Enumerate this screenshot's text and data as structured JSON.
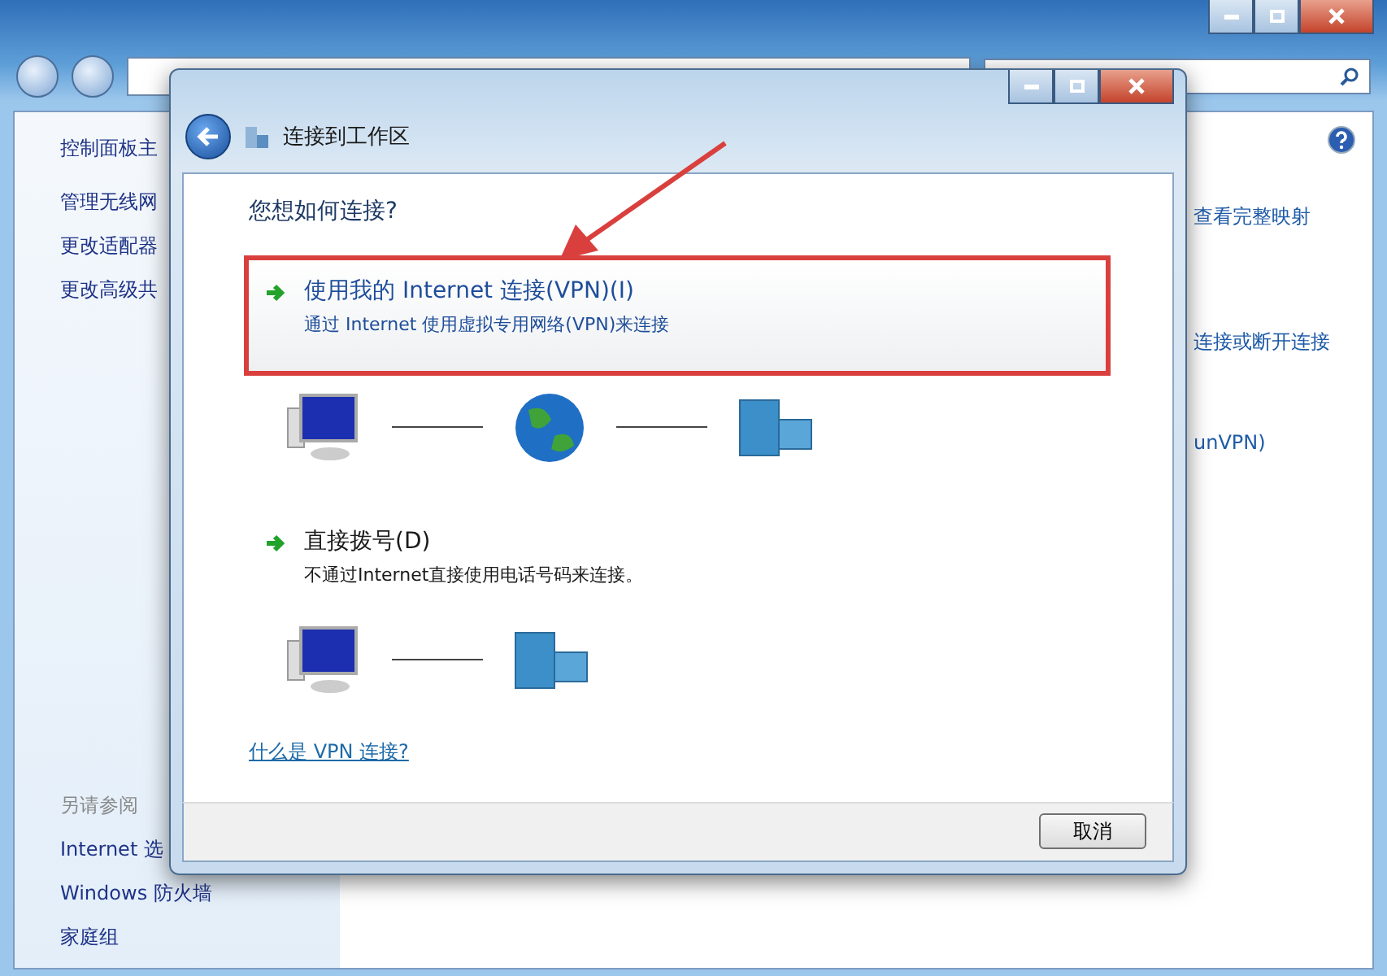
{
  "background_window": {
    "sidebar": {
      "links": [
        "控制面板主",
        "管理无线网",
        "更改适配器",
        "更改高级共"
      ],
      "see_also_heading": "另请参阅",
      "see_also": [
        "Internet 选",
        "Windows 防火墙",
        "家庭组"
      ]
    },
    "right_links": [
      "查看完整映射",
      "连接或断开连接",
      "unVPN)"
    ]
  },
  "dialog": {
    "title": "连接到工作区",
    "question": "您想如何连接?",
    "options": [
      {
        "title": "使用我的 Internet 连接(VPN)(I)",
        "description": "通过 Internet 使用虚拟专用网络(VPN)来连接",
        "highlighted": true,
        "kind": "vpn"
      },
      {
        "title": "直接拨号(D)",
        "description": "不通过Internet直接使用电话号码来连接。",
        "highlighted": false,
        "kind": "dialup"
      }
    ],
    "help_link": "什么是 VPN 连接?",
    "cancel_button": "取消"
  }
}
